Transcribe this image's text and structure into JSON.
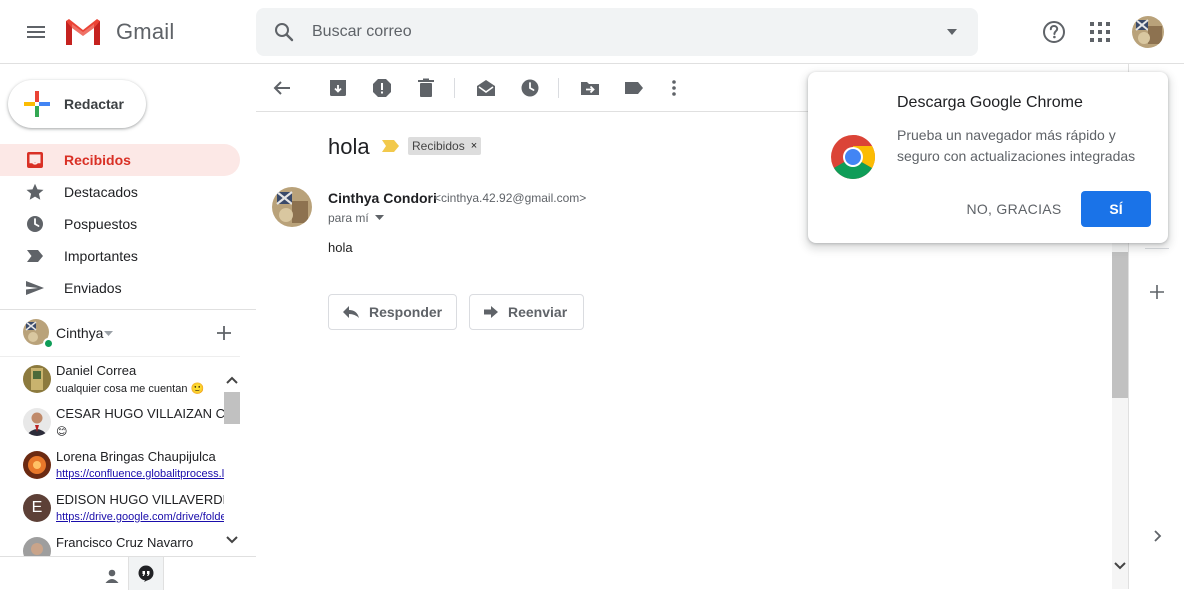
{
  "app": {
    "name": "Gmail"
  },
  "search": {
    "placeholder": "Buscar correo"
  },
  "sidebar": {
    "compose_label": "Redactar",
    "items": [
      {
        "label": "Recibidos",
        "icon": "inbox-icon",
        "active": true
      },
      {
        "label": "Destacados",
        "icon": "star-icon"
      },
      {
        "label": "Pospuestos",
        "icon": "clock-icon"
      },
      {
        "label": "Importantes",
        "icon": "important-icon"
      },
      {
        "label": "Enviados",
        "icon": "send-icon"
      }
    ]
  },
  "hangouts": {
    "me": "Cinthya",
    "contacts": [
      {
        "name": "Daniel Correa",
        "message": "cualquier cosa me cuentan 🙂",
        "link": false
      },
      {
        "name": "CESAR HUGO VILLAIZAN C",
        "message": "😊",
        "link": false
      },
      {
        "name": "Lorena Bringas Chaupijulca",
        "message": "https://confluence.globalitprocess.l",
        "link": true
      },
      {
        "name": "EDISON HUGO VILLAVERDE",
        "message": "https://drive.google.com/drive/folde",
        "link": true,
        "initial": "E"
      },
      {
        "name": "Francisco Cruz Navarro",
        "message": "",
        "link": false
      }
    ]
  },
  "email": {
    "subject": "hola",
    "label": "Recibidos",
    "label_remove": "×",
    "sender_name": "Cinthya Condori",
    "sender_email": "<cinthya.42.92@gmail.com>",
    "to": "para mí",
    "body": "hola",
    "reply_label": "Responder",
    "forward_label": "Reenviar"
  },
  "promo": {
    "title": "Descarga Google Chrome",
    "body": "Prueba un navegador más rápido y seguro con actualizaciones integradas",
    "no_label": "NO, GRACIAS",
    "yes_label": "SÍ"
  },
  "colors": {
    "accent_red": "#d93025",
    "active_bg": "#fce8e6",
    "primary_blue": "#1a73e8",
    "online_green": "#0f9d58"
  }
}
